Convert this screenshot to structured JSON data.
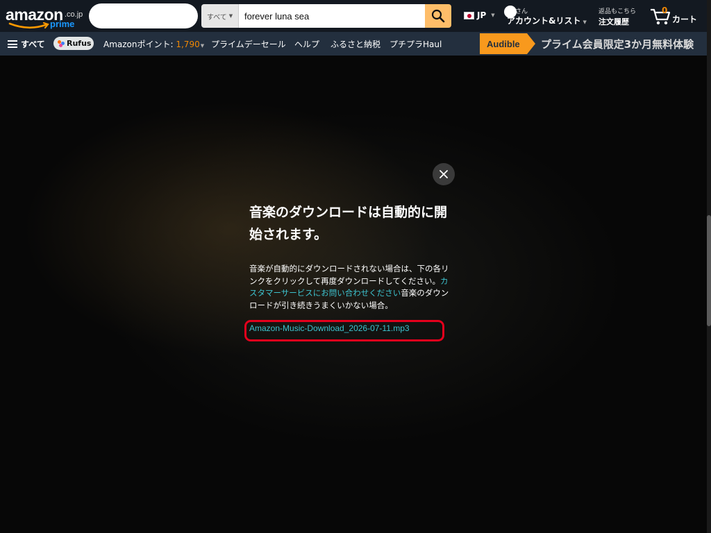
{
  "header": {
    "logo": {
      "word": "amazon",
      "tld": ".co.jp",
      "prime": "prime"
    },
    "search": {
      "category": "すべて",
      "query": "forever luna sea"
    },
    "language": "JP",
    "account": {
      "greeting": "さん",
      "label": "アカウント&リスト"
    },
    "orders": {
      "small": "返品もこちら",
      "label": "注文履歴"
    },
    "cart": {
      "count": "0",
      "label": "カート"
    }
  },
  "subnav": {
    "all": "すべて",
    "rufus": "Rufus",
    "points_label": "Amazonポイント: ",
    "points_value": "1,790",
    "items": [
      "プライムデーセール",
      "ヘルプ",
      "ふるさと納税",
      "プチプラHaul"
    ],
    "audible_badge": "Audible",
    "audible_text": "プライム会員限定3か月無料体験"
  },
  "modal": {
    "title": "音楽のダウンロードは自動的に開始されます。",
    "body_part1": "音楽が自動的にダウンロードされない場合は、下の各リンクをクリックして再度ダウンロードしてください。",
    "cs_link": "カスタマーサービスにお問い合わせください",
    "body_part2": "音楽のダウンロードが引き続きうまくいかない場合。",
    "download_file": "Amazon-Music-Download_2026-07-11.mp3"
  },
  "colors": {
    "nav_dark": "#131921",
    "nav_sub": "#232f3e",
    "search_button": "#febd69",
    "link": "#3dc3cf",
    "points": "#f08804",
    "highlight": "#e5001c",
    "audible": "#f8991d"
  },
  "icons": [
    "search-icon",
    "flag-jp-icon",
    "cart-icon",
    "hamburger-icon",
    "rufus-icon",
    "close-icon"
  ]
}
